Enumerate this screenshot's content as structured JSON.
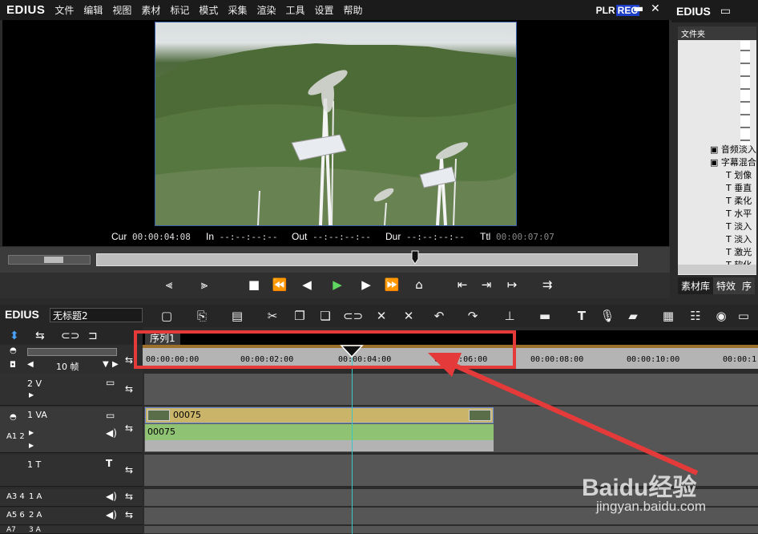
{
  "app": {
    "logo": "EDIUS",
    "menu": [
      "文件",
      "编辑",
      "视图",
      "素材",
      "标记",
      "模式",
      "采集",
      "渲染",
      "工具",
      "设置",
      "帮助"
    ],
    "plr": "PLR",
    "rec": "REC",
    "min_glyph": "▬",
    "close_glyph": "✕"
  },
  "player": {
    "cur_label": "Cur",
    "cur_value": "00:00:04:08",
    "in_label": "In",
    "in_value": "--:--:--:--",
    "out_label": "Out",
    "out_value": "--:--:--:--",
    "dur_label": "Dur",
    "dur_value": "--:--:--:--",
    "ttl_label": "Ttl",
    "ttl_value": "00:00:07:07"
  },
  "right_panel": {
    "logo": "EDIUS",
    "folder_header": "文件夹",
    "tree_items": [
      "音频淡入",
      "字幕混合",
      "划像",
      "垂直",
      "柔化",
      "水平",
      "淡入",
      "淡入",
      "激光",
      "软化"
    ],
    "tabs": [
      "素材库",
      "特效",
      "序"
    ]
  },
  "timeline": {
    "logo": "EDIUS",
    "project_name": "无标题2",
    "sequence_tab": "序列1",
    "zoom_label": "10 帧",
    "ruler": [
      "00:00:00:00",
      "00:00:02:00",
      "00:00:04:00",
      "00:00:06:00",
      "00:00:08:00",
      "00:00:10:00",
      "00:00:1"
    ],
    "tracks": [
      {
        "name": "2 V"
      },
      {
        "name": "1 VA"
      },
      {
        "name": "1 T"
      },
      {
        "name": "1 A"
      },
      {
        "name": "2 A"
      },
      {
        "name": "3 A"
      }
    ],
    "clip_video_name": "00075",
    "clip_audio_name": "00075",
    "audio_badges": [
      "A1 2",
      "A3 4",
      "A5 6",
      "A7"
    ]
  },
  "watermark": {
    "brand": "Baidu经验",
    "url": "jingyan.baidu.com"
  },
  "colors": {
    "highlight_box": "#e53a3a",
    "rec_blue": "#1d3fc8",
    "clip_video": "#c9b46a",
    "clip_audio": "#8fc272",
    "playhead": "#39c6c6"
  }
}
